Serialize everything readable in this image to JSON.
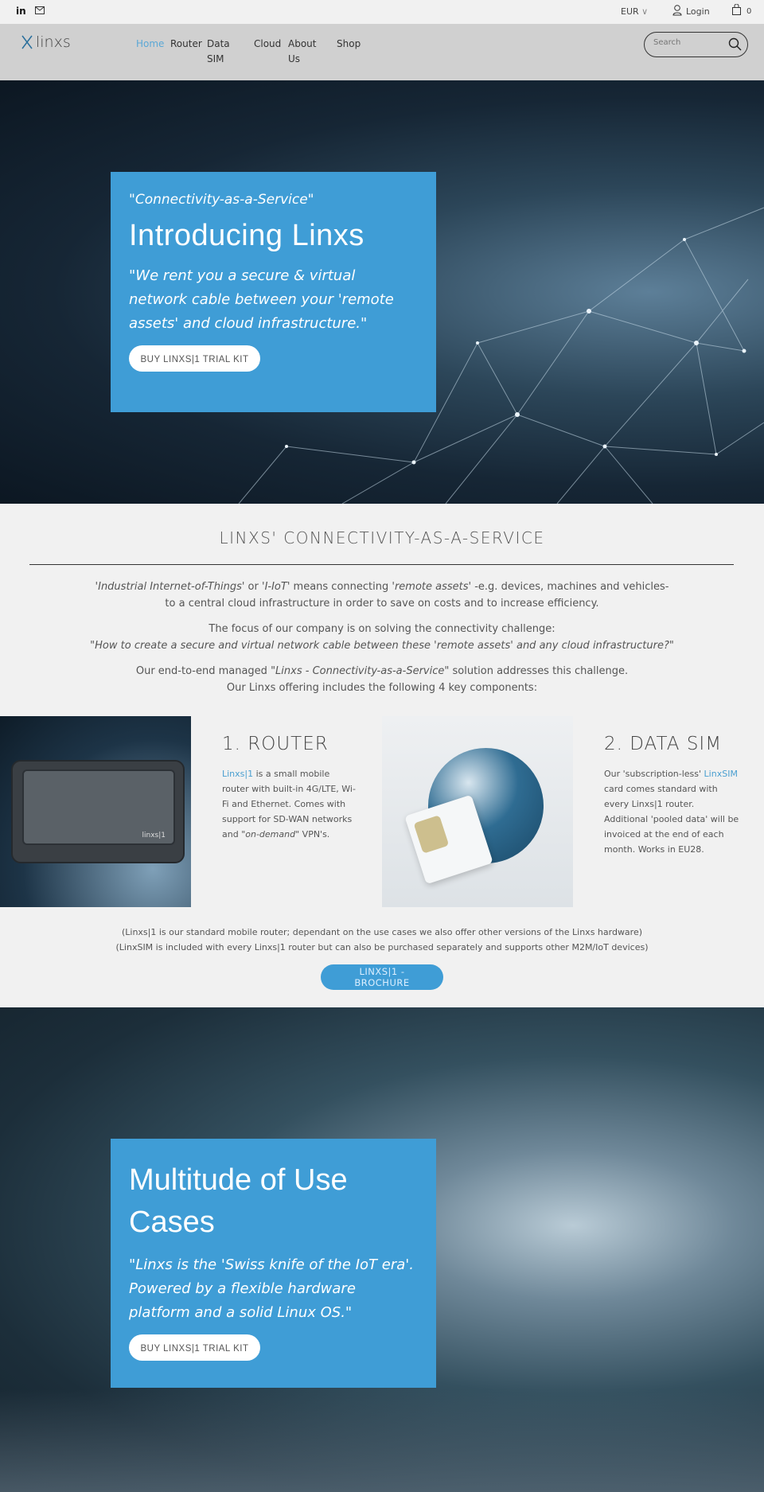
{
  "topbar": {
    "currency": "EUR",
    "login": "Login",
    "cart_count": "0"
  },
  "nav": {
    "logo": "linxs",
    "items": [
      "Home",
      "Router",
      "Data SIM",
      "Cloud",
      "About Us",
      "Shop"
    ],
    "search_placeholder": "Search"
  },
  "hero1": {
    "tagline": "\"Connectivity-as-a-Service\"",
    "title": "Introducing Linxs",
    "quote": "\"We rent you a secure & virtual network cable between your 'remote assets' and cloud infrastructure.\"",
    "button": "BUY LINXS|1 TRIAL KIT"
  },
  "intro": {
    "heading": "LINXS' CONNECTIVITY-AS-A-SERVICE",
    "p1a": "'Industrial Internet-of-Things'",
    "p1b": " or ",
    "p1c": "'I-IoT'",
    "p1d": " means connecting '",
    "p1e": "remote assets",
    "p1f": "' -e.g. devices, machines and vehicles-",
    "p1g": "to a central cloud infrastructure in order to save on costs and to increase efficiency.",
    "p2a": "The focus of our company is on solving the connectivity challenge:",
    "p2b": "\"How to create a secure and virtual network cable between these 'remote assets' and any cloud infrastructure?\"",
    "p3a": "Our end-to-end managed \"",
    "p3b": "Linxs - Connectivity-as-a-Service",
    "p3c": "\" solution addresses this challenge.",
    "p3d": "Our Linxs offering includes the following 4 key components:"
  },
  "products": [
    {
      "title": "1. ROUTER",
      "link": "Linxs|1",
      "desc": " is a small mobile router with built-in 4G/LTE, Wi-Fi and Ethernet. Comes with support for SD-WAN networks and \"",
      "em": "on-demand",
      "desc2": "\" VPN's.",
      "image_label": "linxs|1"
    },
    {
      "title": "2. DATA SIM",
      "desc": "Our 'subscription-less' ",
      "link": "LinxSIM",
      "desc2": " card comes standard with every Linxs|1 router. Additional 'pooled data' will be invoiced at the end of each month. Works in EU28."
    }
  ],
  "notes": [
    "(Linxs|1 is our standard mobile router; dependant on the use cases we also offer other versions of the Linxs hardware)",
    "(LinxSIM is included with every Linxs|1 router but can also be purchased separately and supports other M2M/IoT devices)"
  ],
  "brochure_button": "LINXS|1 - BROCHURE",
  "hero2": {
    "title": "Multitude of Use Cases",
    "quote": "\"Linxs is the 'Swiss knife of the IoT era'. Powered by a flexible hardware platform and a solid Linux OS.\"",
    "button": "BUY LINXS|1 TRIAL KIT"
  },
  "colors": {
    "accent": "#3f9dd6",
    "nav_bg": "#d0d0d0",
    "page_bg": "#f1f1f1",
    "link": "#4a9fd0"
  }
}
